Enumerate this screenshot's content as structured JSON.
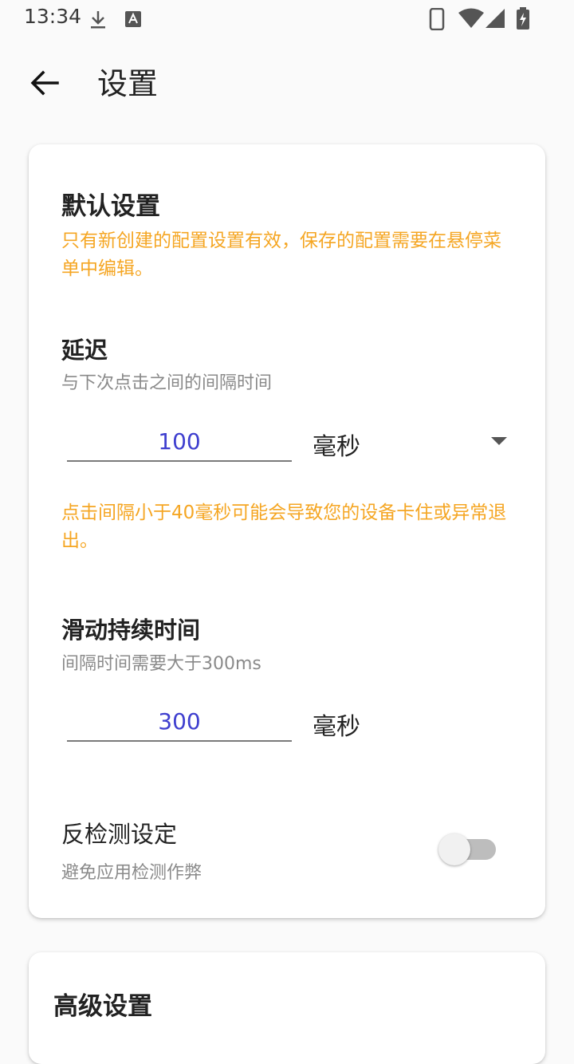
{
  "status_bar": {
    "time": "13:34",
    "icons": [
      "download-icon",
      "font-a-icon",
      "phone-icon",
      "wifi-icon",
      "signal-icon",
      "battery-charging-icon"
    ]
  },
  "app_bar": {
    "title": "设置",
    "back_icon": "arrow-back-icon"
  },
  "default_settings": {
    "title": "默认设置",
    "note": "只有新创建的配置设置有效，保存的配置需要在悬停菜单中编辑。",
    "delay": {
      "title": "延迟",
      "subtitle": "与下次点击之间的间隔时间",
      "value": "100",
      "unit": "毫秒",
      "warning": "点击间隔小于40毫秒可能会导致您的设备卡住或异常退出。"
    },
    "swipe": {
      "title": "滑动持续时间",
      "subtitle": "间隔时间需要大于300ms",
      "value": "300",
      "unit": "毫秒"
    },
    "anti_detect": {
      "title": "反检测设定",
      "subtitle": "避免应用检测作弊",
      "enabled": false
    }
  },
  "advanced_settings": {
    "title": "高级设置"
  },
  "colors": {
    "accent_text": "#3f3fcf",
    "warning": "#f5a623"
  }
}
